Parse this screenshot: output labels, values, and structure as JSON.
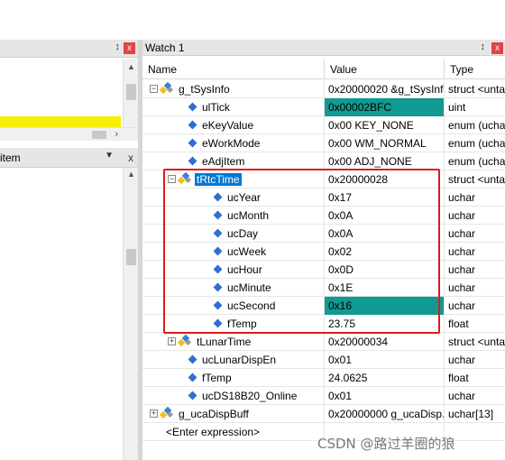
{
  "left_top": {
    "pin_glyph": "↕",
    "close_glyph": "x"
  },
  "left_bottom": {
    "label": "item",
    "dropdown_glyph": "▼",
    "close_glyph": "x"
  },
  "watch": {
    "title": "Watch 1",
    "pin_glyph": "↕",
    "close_glyph": "x",
    "columns": {
      "name": "Name",
      "value": "Value",
      "type": "Type"
    },
    "rows": [
      {
        "name": "g_tSysInfo",
        "value": "0x20000020 &g_tSysInfo",
        "type": "struct <unta",
        "level": 0,
        "icon": "struct",
        "expander": "−"
      },
      {
        "name": "ulTick",
        "value": "0x00002BFC",
        "type": "uint",
        "level": 1,
        "icon": "field",
        "value_highlight": "teal"
      },
      {
        "name": "eKeyValue",
        "value": "0x00 KEY_NONE",
        "type": "enum (ucha",
        "level": 1,
        "icon": "field"
      },
      {
        "name": "eWorkMode",
        "value": "0x00 WM_NORMAL",
        "type": "enum (ucha",
        "level": 1,
        "icon": "field"
      },
      {
        "name": "eAdjItem",
        "value": "0x00 ADJ_NONE",
        "type": "enum (ucha",
        "level": 1,
        "icon": "field"
      },
      {
        "name": "tRtcTime",
        "value": "0x20000028",
        "type": "struct <unta",
        "level": 1,
        "icon": "struct",
        "expander": "−",
        "selected": true
      },
      {
        "name": "ucYear",
        "value": "0x17",
        "type": "uchar",
        "level": 2,
        "icon": "field"
      },
      {
        "name": "ucMonth",
        "value": "0x0A",
        "type": "uchar",
        "level": 2,
        "icon": "field"
      },
      {
        "name": "ucDay",
        "value": "0x0A",
        "type": "uchar",
        "level": 2,
        "icon": "field"
      },
      {
        "name": "ucWeek",
        "value": "0x02",
        "type": "uchar",
        "level": 2,
        "icon": "field"
      },
      {
        "name": "ucHour",
        "value": "0x0D",
        "type": "uchar",
        "level": 2,
        "icon": "field"
      },
      {
        "name": "ucMinute",
        "value": "0x1E",
        "type": "uchar",
        "level": 2,
        "icon": "field"
      },
      {
        "name": "ucSecond",
        "value": "0x16",
        "type": "uchar",
        "level": 2,
        "icon": "field",
        "value_highlight": "teal"
      },
      {
        "name": "fTemp",
        "value": "23.75",
        "type": "float",
        "level": 2,
        "icon": "field"
      },
      {
        "name": "tLunarTime",
        "value": "0x20000034",
        "type": "struct <unta",
        "level": 1,
        "icon": "struct",
        "expander": "+"
      },
      {
        "name": "ucLunarDispEn",
        "value": "0x01",
        "type": "uchar",
        "level": 1,
        "icon": "field"
      },
      {
        "name": "fTemp",
        "value": "24.0625",
        "type": "float",
        "level": 1,
        "icon": "field"
      },
      {
        "name": "ucDS18B20_Online",
        "value": "0x01",
        "type": "uchar",
        "level": 1,
        "icon": "field"
      },
      {
        "name": "g_ucaDispBuff",
        "value": "0x20000000 g_ucaDisp...",
        "type": "uchar[13]",
        "level": 0,
        "icon": "struct",
        "expander": "+"
      },
      {
        "name": "<Enter expression>",
        "value": "",
        "type": "",
        "level": 0,
        "icon": "none"
      }
    ]
  },
  "colors": {
    "selection": "#0078d7",
    "highlight_teal": "#109a91",
    "annotation_red": "#e0191b",
    "yellow_line": "#f7f000"
  },
  "watermark": "CSDN @路过羊圈的狼"
}
